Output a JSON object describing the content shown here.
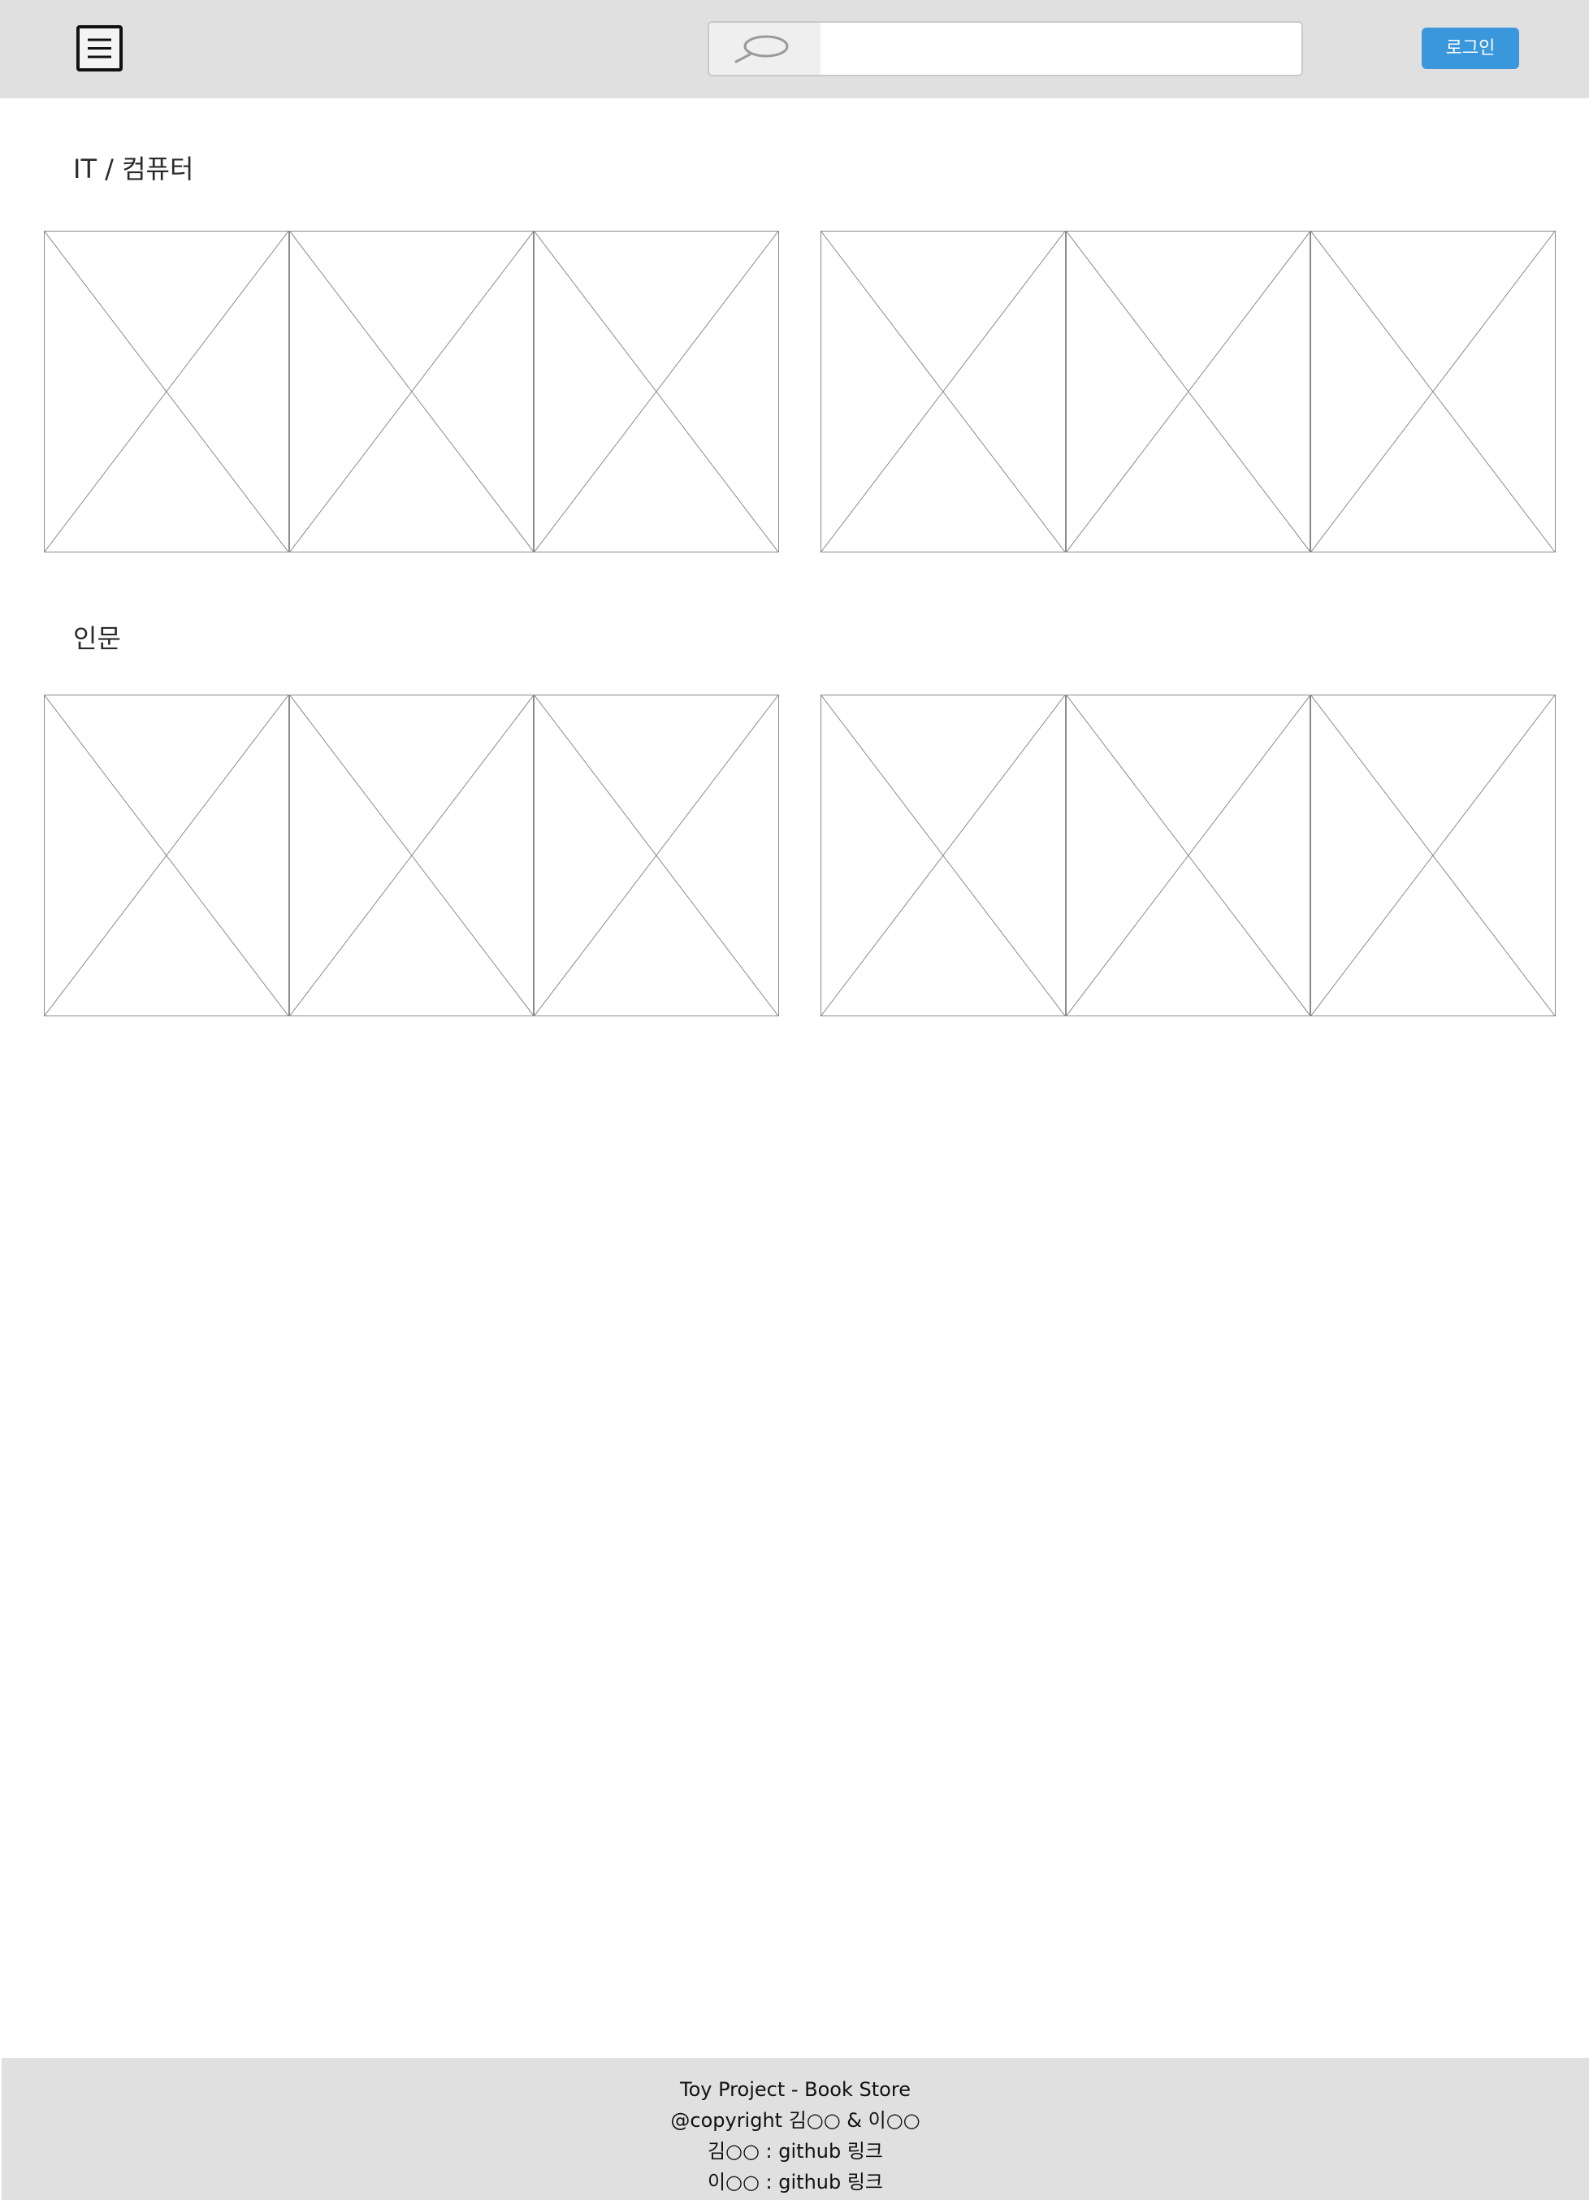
{
  "header": {
    "menu_icon": "hamburger-menu-icon",
    "search": {
      "icon": "magnifier-icon",
      "value": "",
      "placeholder": ""
    },
    "login_label": "로그인",
    "login_color": "#3a97dc",
    "background_color": "#e0e0e0"
  },
  "sections": [
    {
      "title": "IT / 컴퓨터",
      "groups": [
        {
          "items": [
            "image-placeholder",
            "image-placeholder",
            "image-placeholder"
          ]
        },
        {
          "items": [
            "image-placeholder",
            "image-placeholder",
            "image-placeholder"
          ]
        }
      ]
    },
    {
      "title": "인문",
      "groups": [
        {
          "items": [
            "image-placeholder",
            "image-placeholder",
            "image-placeholder"
          ]
        },
        {
          "items": [
            "image-placeholder",
            "image-placeholder",
            "image-placeholder"
          ]
        }
      ]
    }
  ],
  "footer": {
    "line1": "Toy Project - Book Store",
    "line2": "@copyright 김○○ & 이○○",
    "line3": "김○○ : github 링크",
    "line4": "이○○ : github 링크",
    "background_color": "#e0e0e0"
  }
}
